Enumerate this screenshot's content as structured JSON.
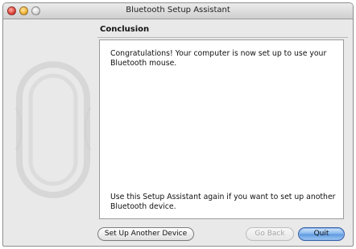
{
  "window": {
    "title": "Bluetooth Setup Assistant"
  },
  "page": {
    "heading": "Conclusion",
    "message_top": "Congratulations! Your computer is now set up to use your Bluetooth mouse.",
    "message_bottom": "Use this Setup Assistant again if you want to set up another Bluetooth device."
  },
  "buttons": {
    "setup_another": "Set Up Another Device",
    "go_back": "Go Back",
    "quit": "Quit"
  },
  "illustration": {
    "icon": "bluetooth-mouse-watermark-icon"
  }
}
